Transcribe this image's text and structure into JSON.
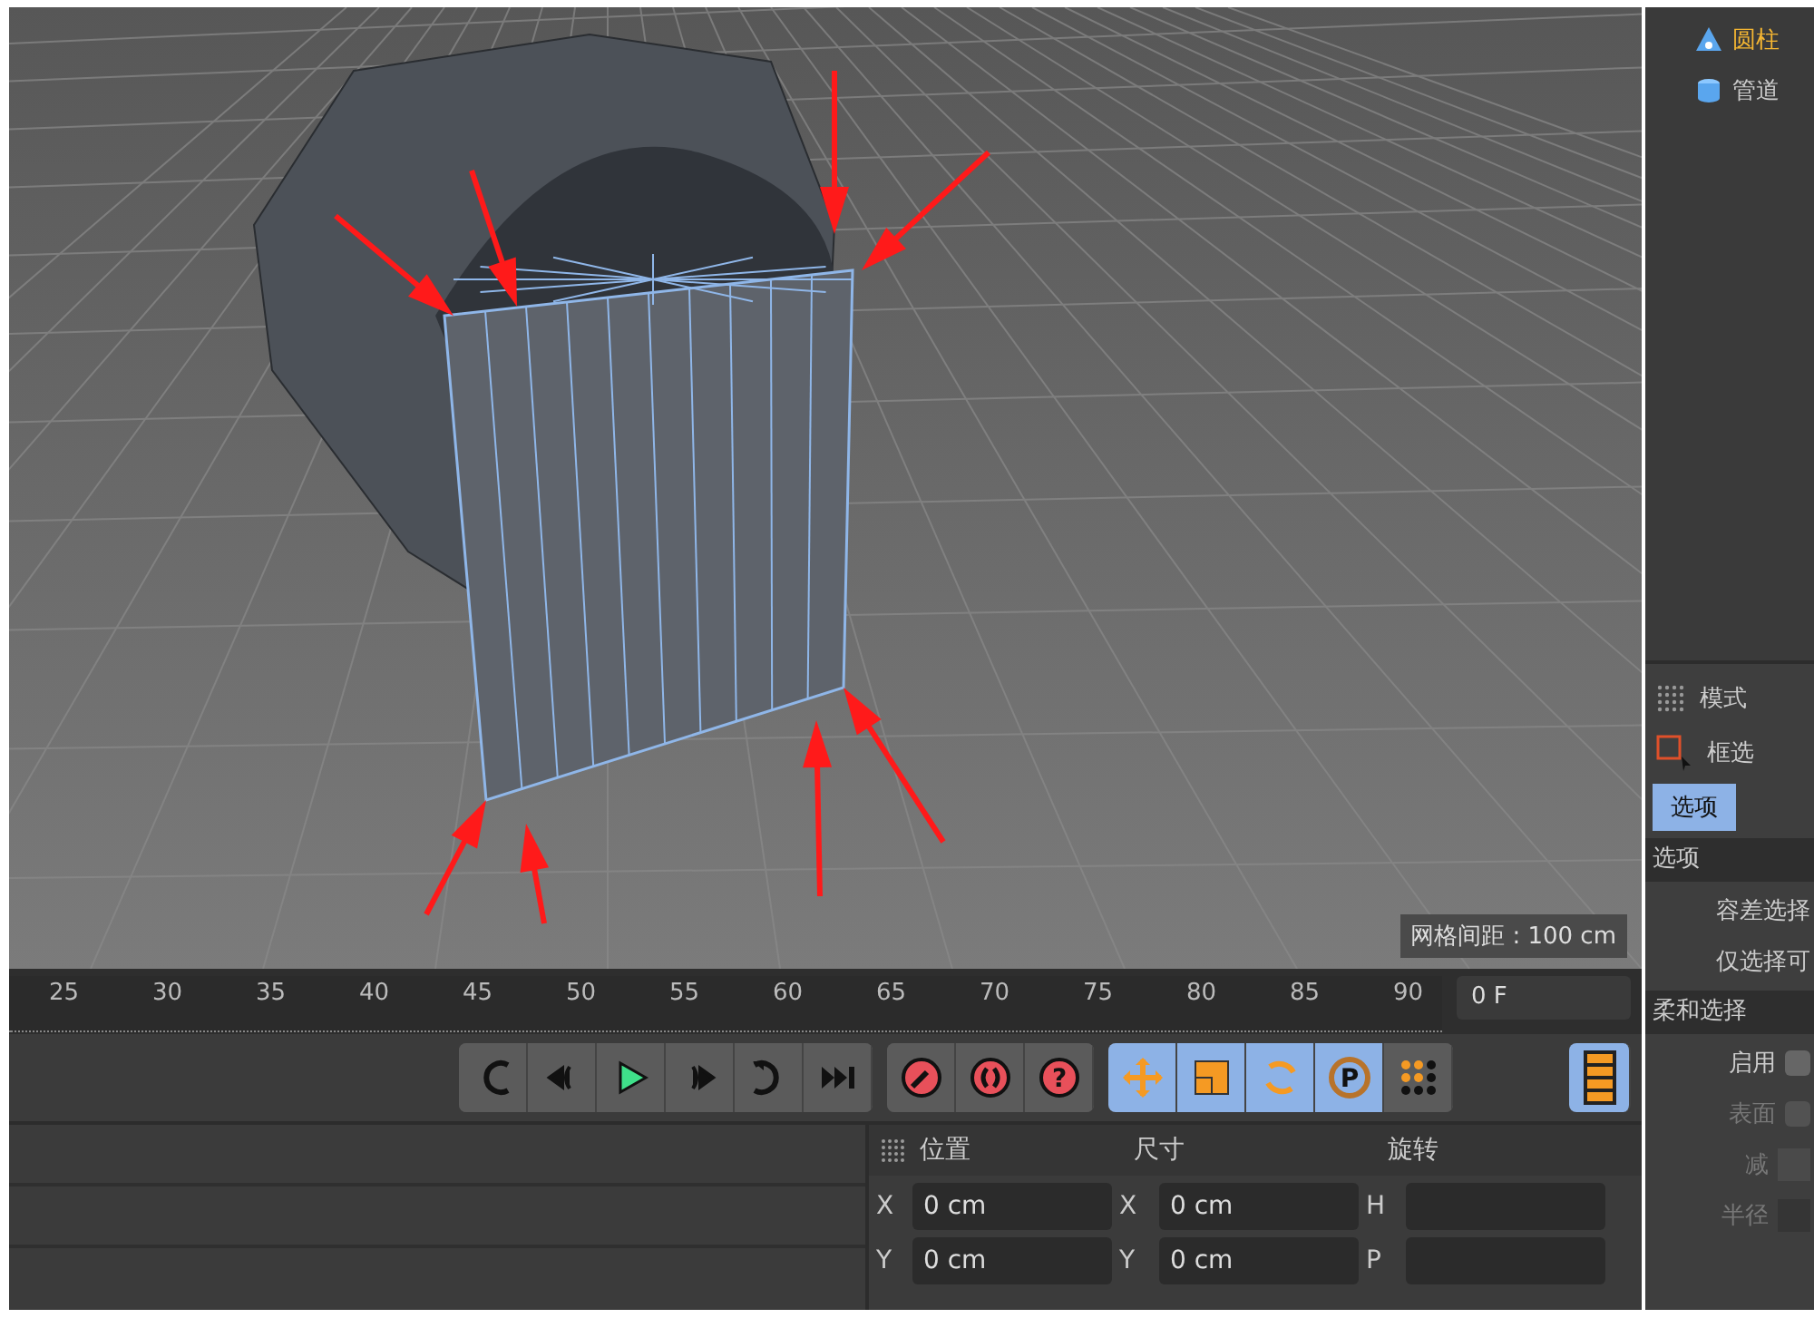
{
  "object_tree": [
    {
      "label": "圆柱",
      "selected": true,
      "kind": "cylinder"
    },
    {
      "label": "管道",
      "selected": false,
      "kind": "tube"
    }
  ],
  "viewport": {
    "grid_spacing": "网格间距 : 100 cm"
  },
  "timeline": {
    "ticks": [
      "25",
      "30",
      "35",
      "40",
      "45",
      "50",
      "55",
      "60",
      "65",
      "70",
      "75",
      "80",
      "85",
      "90"
    ],
    "current_frame": "0 F"
  },
  "playback_buttons": [
    {
      "kind": "loop-back"
    },
    {
      "kind": "prev-key"
    },
    {
      "kind": "play"
    },
    {
      "kind": "next-key"
    },
    {
      "kind": "loop"
    },
    {
      "kind": "end"
    }
  ],
  "record_buttons": [
    {
      "kind": "key"
    },
    {
      "kind": "auto"
    },
    {
      "kind": "help",
      "glyph": "?"
    }
  ],
  "track_toggles": [
    {
      "kind": "move",
      "on": true
    },
    {
      "kind": "scale",
      "on": true
    },
    {
      "kind": "rotate",
      "on": true
    },
    {
      "kind": "param",
      "on": true,
      "glyph": "P"
    },
    {
      "kind": "points",
      "on": false
    }
  ],
  "timeline_toggle": {
    "on": true
  },
  "coordinates": {
    "headers": [
      "位置",
      "尺寸",
      "旋转"
    ],
    "rows": [
      {
        "label_1": "X",
        "value_1": "0 cm",
        "label_2": "X",
        "value_2": "0 cm",
        "label_3": "H"
      },
      {
        "label_1": "Y",
        "value_1": "0 cm",
        "label_2": "Y",
        "value_2": "0 cm",
        "label_3": "P"
      }
    ]
  },
  "attributes": {
    "mode": "模式",
    "tool": "框选",
    "tabs": [
      {
        "label": "选项",
        "selected": true
      }
    ],
    "section": "选项",
    "rows": [
      {
        "label": "容差选择",
        "disabled": false
      },
      {
        "label": "仅选择可",
        "disabled": false
      }
    ],
    "soft_section": "柔和选择",
    "soft_rows": [
      {
        "label": "启用",
        "kind": "checkbox",
        "disabled": false,
        "checked": false
      },
      {
        "label": "表面",
        "kind": "checkbox",
        "disabled": true,
        "checked": false
      },
      {
        "label": "减",
        "kind": "dropdown",
        "disabled": true
      },
      {
        "label": "半径",
        "kind": "field",
        "disabled": true
      }
    ]
  }
}
